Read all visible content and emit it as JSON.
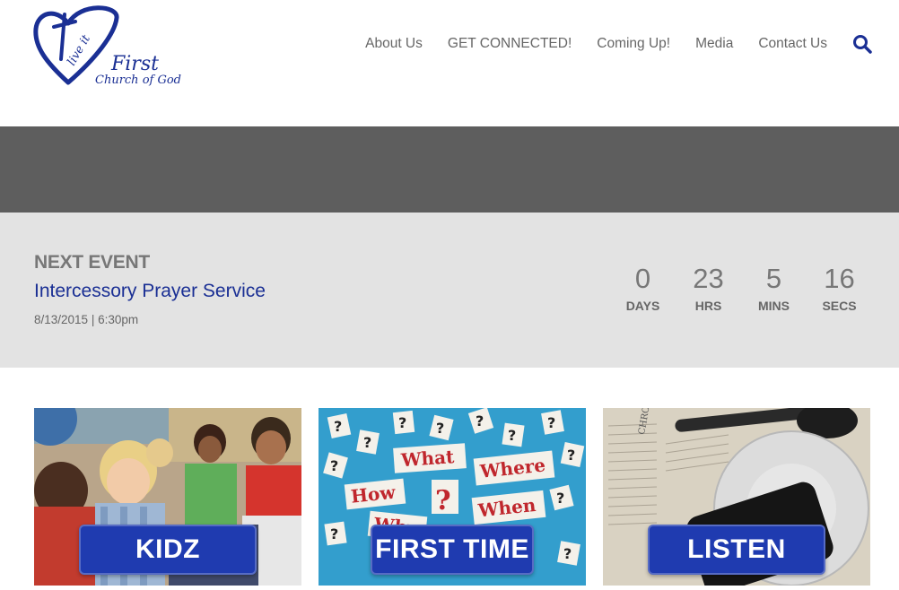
{
  "header": {
    "logo": {
      "tagline": "live it",
      "name_line1": "First",
      "name_line2": "Church of God"
    },
    "nav": [
      {
        "label": "About Us"
      },
      {
        "label": "GET CONNECTED!"
      },
      {
        "label": "Coming Up!"
      },
      {
        "label": "Media"
      },
      {
        "label": "Contact Us"
      }
    ],
    "search_icon": "search-icon"
  },
  "event": {
    "kicker": "NEXT EVENT",
    "title": "Intercessory Prayer Service",
    "date": "8/13/2015",
    "separator": "|",
    "time": "6:30pm",
    "countdown": [
      {
        "value": "0",
        "label": "DAYS"
      },
      {
        "value": "23",
        "label": "HRS"
      },
      {
        "value": "5",
        "label": "MINS"
      },
      {
        "value": "16",
        "label": "SECS"
      }
    ]
  },
  "tiles": [
    {
      "label": "KIDZ"
    },
    {
      "label": "FIRST TIME",
      "photo_words": [
        "What",
        "Where",
        "How",
        "When",
        "Why"
      ]
    },
    {
      "label": "LISTEN",
      "photo_text": "CHRON"
    }
  ],
  "colors": {
    "brand_blue": "#1a2f94",
    "button_blue": "#1f3bb0",
    "dark_band": "#5e5e5e",
    "event_bg": "#e3e3e3"
  }
}
